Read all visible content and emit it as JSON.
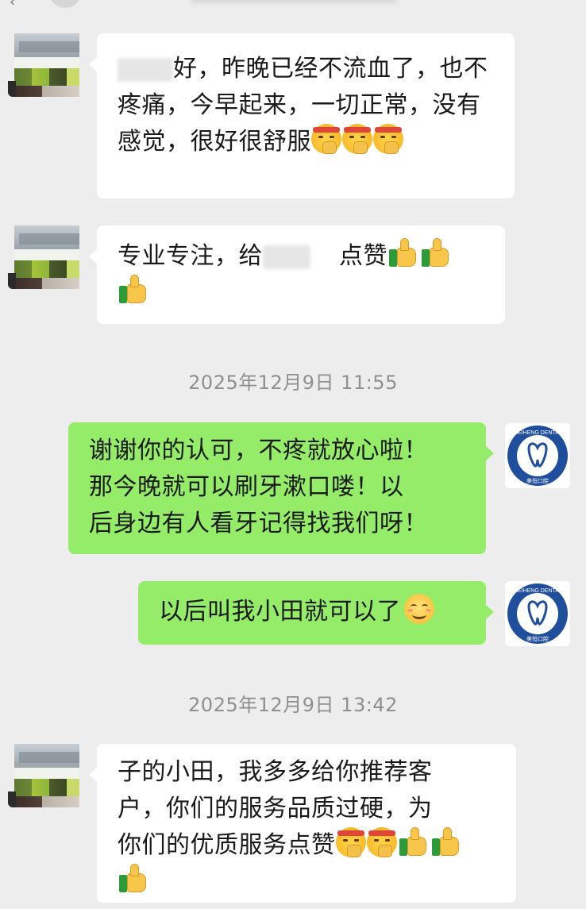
{
  "colors": {
    "background": "#ededed",
    "incoming_bubble": "#ffffff",
    "outgoing_bubble": "#95ec69",
    "timestamp_text": "#8f8f8f",
    "logo_blue": "#1f4e9c"
  },
  "messages": [
    {
      "direction": "incoming",
      "text_prefix": "好，昨晚已经不流血了，也不疼痛，今早起来，一切正常，没有感觉，很好很舒服",
      "emojis": [
        "salute-face-emoji",
        "salute-face-emoji",
        "salute-face-emoji"
      ]
    },
    {
      "direction": "incoming",
      "text_part1": "专业专注，给",
      "text_part2": "点赞",
      "emojis": [
        "thumbs-up-emoji",
        "thumbs-up-emoji",
        "thumbs-up-emoji"
      ]
    },
    {
      "direction": "timestamp",
      "text": "2025年12月9日 11:55"
    },
    {
      "direction": "outgoing",
      "line1": "谢谢你的认可，不疼就放心啦！",
      "line2": "那今晚就可以刷牙漱口喽！以",
      "line3": "后身边有人看牙记得找我们呀！"
    },
    {
      "direction": "outgoing",
      "text": "以后叫我小田就可以了",
      "emojis": [
        "smile-emoji"
      ]
    },
    {
      "direction": "timestamp",
      "text": "2025年12月9日 13:42"
    },
    {
      "direction": "incoming",
      "line1": "子的小田，我多多给你推荐客",
      "line2": "户，你们的服务品质过硬，为",
      "line3": "你们的优质服务点赞",
      "emojis": [
        "salute-face-emoji",
        "salute-face-emoji",
        "thumbs-up-emoji",
        "thumbs-up-emoji",
        "thumbs-up-emoji"
      ]
    }
  ],
  "self_avatar": {
    "logo_text": "MEIHENG DENTAL",
    "logo_cn": "美恒口腔"
  }
}
